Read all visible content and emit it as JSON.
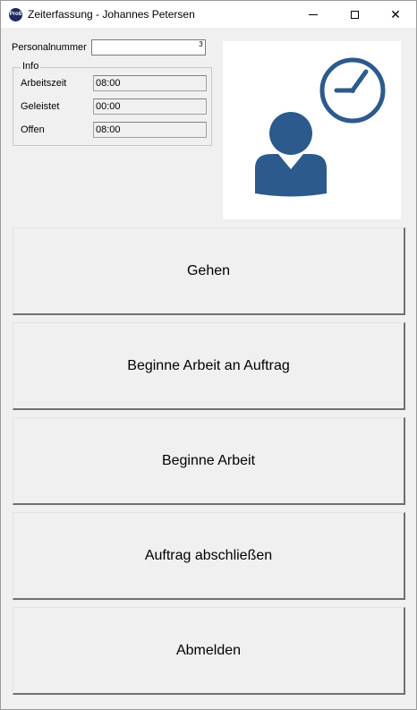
{
  "window": {
    "title": "Zeiterfassung - Johannes Petersen",
    "icon_text": "Proß",
    "controls": {
      "minimize_icon": "minimize-icon",
      "maximize_icon": "maximize-icon",
      "close_icon": "close-icon",
      "close_glyph": "✕"
    }
  },
  "personalnummer": {
    "label": "Personalnummer",
    "value": "",
    "spinner": "3"
  },
  "info": {
    "title": "Info",
    "rows": [
      {
        "label": "Arbeitszeit",
        "value": "08:00"
      },
      {
        "label": "Geleistet",
        "value": "00:00"
      },
      {
        "label": "Offen",
        "value": "08:00"
      }
    ]
  },
  "logo": {
    "icon": "person-clock-icon",
    "color": "#2c5a8c"
  },
  "buttons": [
    {
      "label": "Gehen"
    },
    {
      "label": "Beginne Arbeit an Auftrag"
    },
    {
      "label": "Beginne Arbeit"
    },
    {
      "label": "Auftrag abschließen"
    },
    {
      "label": "Abmelden"
    }
  ]
}
